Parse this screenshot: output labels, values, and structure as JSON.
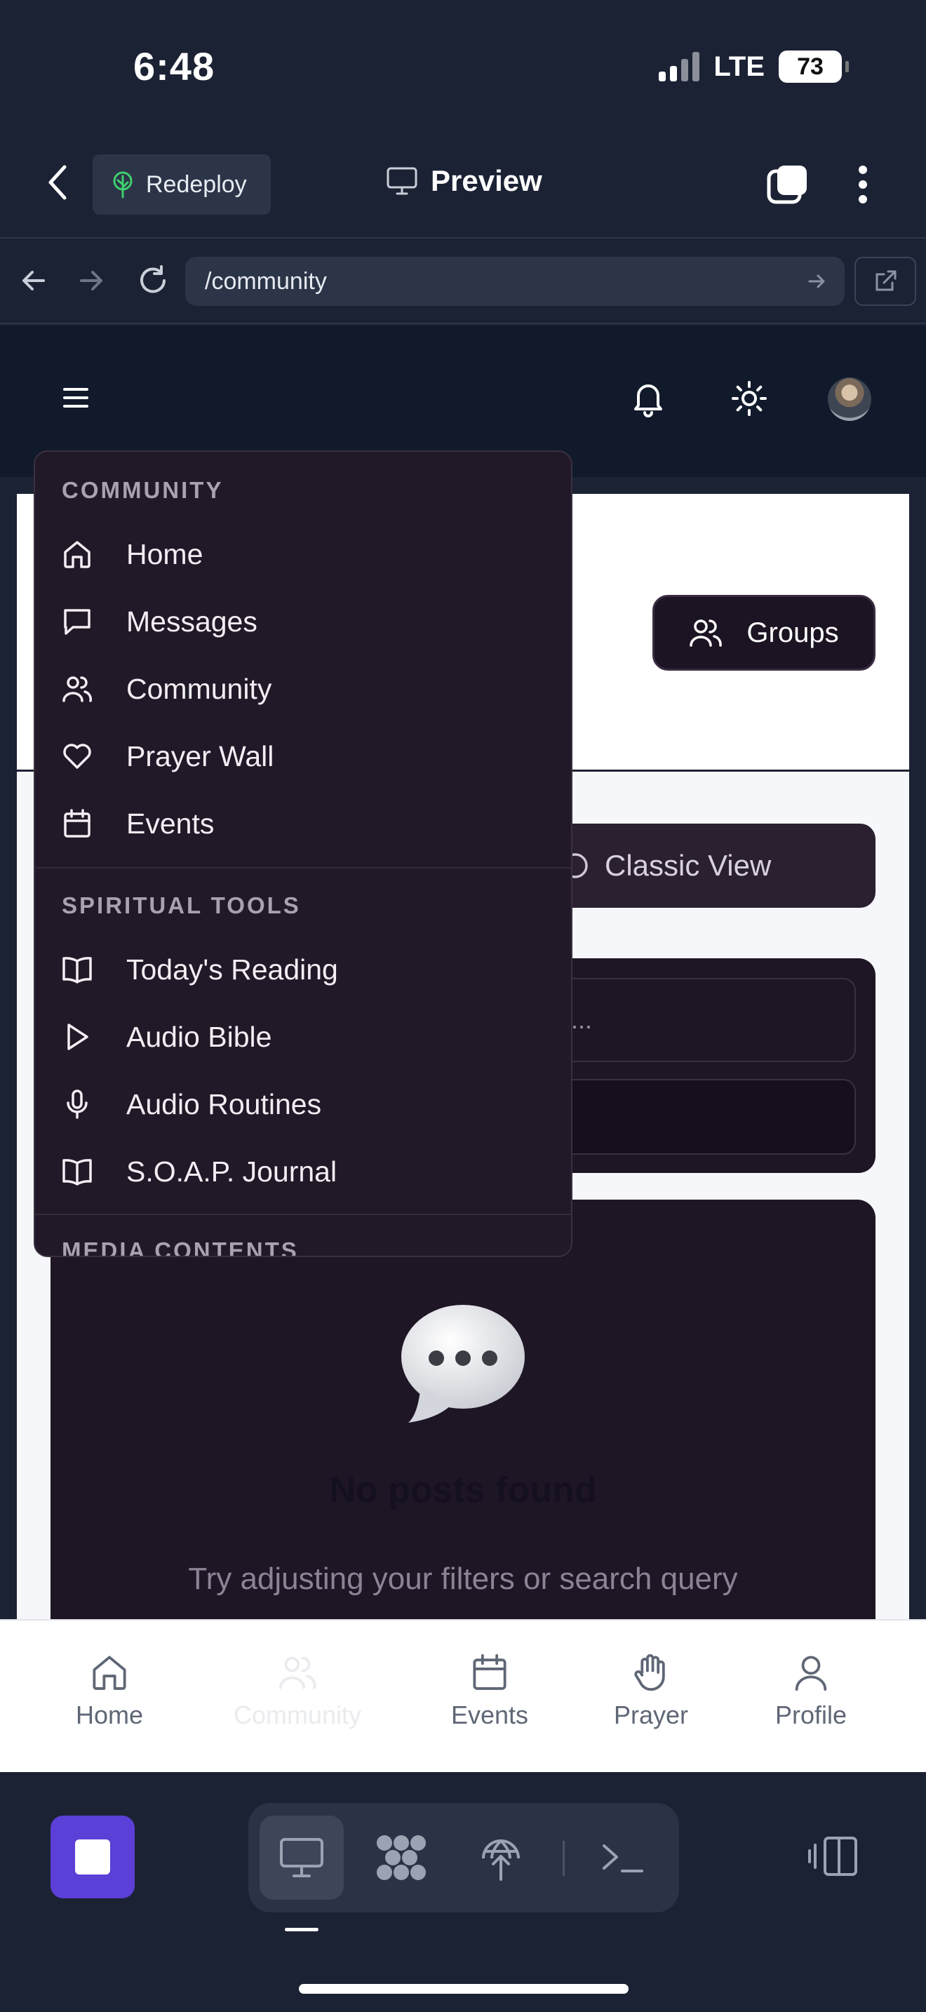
{
  "status_bar": {
    "time": "6:48",
    "network": "LTE",
    "battery": "73"
  },
  "preview_header": {
    "redeploy_label": "Redeploy",
    "preview_label": "Preview"
  },
  "browser": {
    "url": "/community"
  },
  "page": {
    "groups_label": "Groups",
    "classic_view_label": "Classic View",
    "search_placeholder": "...",
    "empty_title": "No posts found",
    "empty_hint": "Try adjusting your filters or search query"
  },
  "menu": {
    "sections": [
      {
        "title": "COMMUNITY",
        "items": [
          {
            "label": "Home",
            "icon": "home-icon"
          },
          {
            "label": "Messages",
            "icon": "message-icon"
          },
          {
            "label": "Community",
            "icon": "users-icon"
          },
          {
            "label": "Prayer Wall",
            "icon": "heart-icon"
          },
          {
            "label": "Events",
            "icon": "calendar-icon"
          }
        ]
      },
      {
        "title": "SPIRITUAL TOOLS",
        "items": [
          {
            "label": "Today's Reading",
            "icon": "book-open-icon"
          },
          {
            "label": "Audio Bible",
            "icon": "play-icon"
          },
          {
            "label": "Audio Routines",
            "icon": "microphone-icon"
          },
          {
            "label": "S.O.A.P. Journal",
            "icon": "book-open-icon"
          }
        ]
      },
      {
        "title": "MEDIA CONTENTS",
        "items": []
      }
    ]
  },
  "tabbar": {
    "items": [
      {
        "label": "Home",
        "icon": "home-icon"
      },
      {
        "label": "Community",
        "icon": "users-icon",
        "faded": true
      },
      {
        "label": "Events",
        "icon": "calendar-icon"
      },
      {
        "label": "Prayer",
        "icon": "hand-icon"
      },
      {
        "label": "Profile",
        "icon": "user-icon"
      }
    ]
  },
  "colors": {
    "app_header": "#111a2b",
    "menu_background": "#211927",
    "stop_button": "#5b3fd6",
    "chrome_background": "#1b2234"
  }
}
